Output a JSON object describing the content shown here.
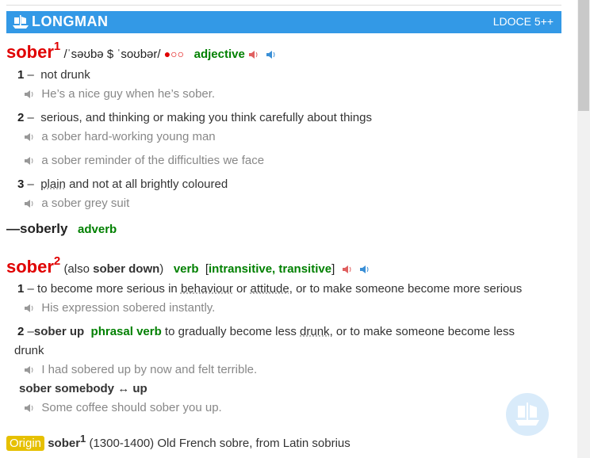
{
  "banner": {
    "brand": "LONGMAN",
    "edition": "LDOCE 5++"
  },
  "entry1": {
    "headword": "sober",
    "homnum": "1",
    "pron": "/ˈsəʊbə $ ˈsoʊbər/",
    "freq": "●○○",
    "pos": "adjective",
    "senses": [
      {
        "num": "1",
        "def": "not drunk",
        "examples": [
          "He’s a nice guy when he’s sober."
        ]
      },
      {
        "num": "2",
        "def": "serious, and thinking or making you think carefully about things",
        "examples": [
          "a sober hard-working young man",
          "a sober reminder of the difficulties we face"
        ]
      },
      {
        "num": "3",
        "def_link": "plain",
        "def_rest": " and not at all brightly coloured",
        "examples": [
          "a sober grey suit"
        ]
      }
    ],
    "runon": {
      "prefix": "—",
      "word": "soberly",
      "pos": "adverb"
    }
  },
  "entry2": {
    "headword": "sober",
    "homnum": "2",
    "also_open": "(also ",
    "also_word": "sober down",
    "also_close": ")",
    "pos": "verb",
    "gram_open": "[",
    "gram": "intransitive, transitive",
    "gram_close": "]",
    "sense1": {
      "num": "1",
      "d1": "to become more serious in ",
      "l1": "behaviour",
      "d2": " or ",
      "l2": "attitude",
      "d3": ", or to make someone become more serious",
      "example": "His expression sobered instantly."
    },
    "sense2": {
      "num": "2",
      "phrase": "sober up",
      "pos": "phrasal verb",
      "d1": " to gradually become less ",
      "l1": "drunk",
      "d2": ", or to make someone become less",
      "d3": "drunk",
      "example": "I had sobered up by now and felt terrible."
    },
    "phrase2": {
      "text": "sober somebody ↔ up",
      "example": "Some coffee should sober you up."
    }
  },
  "origin": {
    "label": "Origin",
    "word": "sober",
    "homnum": "1",
    "text": " (1300-1400) Old French sobre, from Latin sobrius"
  }
}
